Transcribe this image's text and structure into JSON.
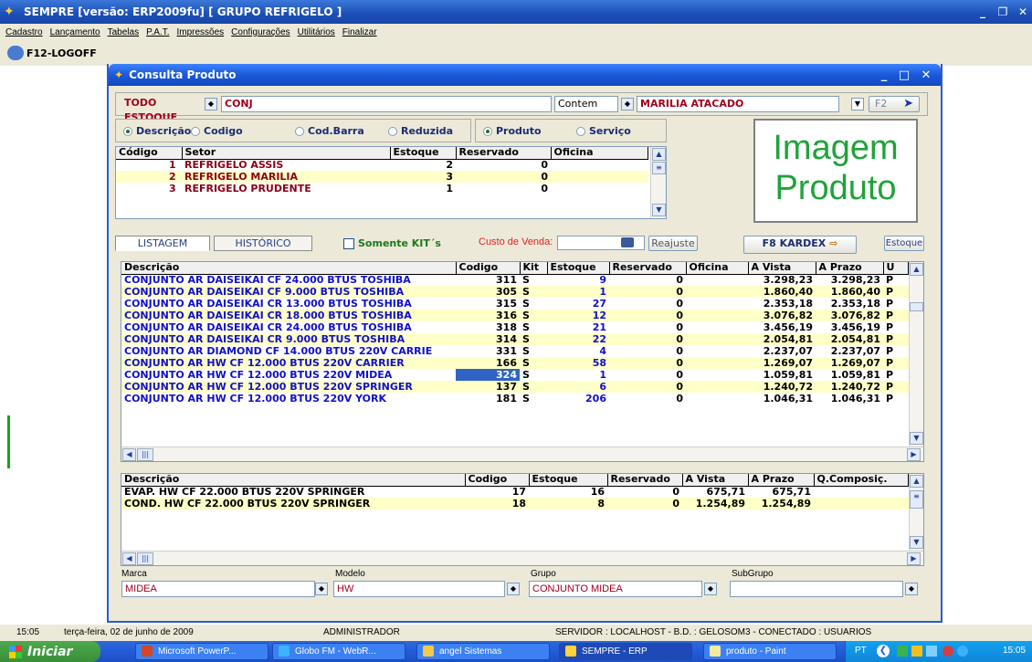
{
  "app": {
    "title": "SEMPRE  [versão: ERP2009fu] [ GRUPO REFRIGELO ]"
  },
  "menu": [
    "Cadastro",
    "Lançamento",
    "Tabelas",
    "P.A.T.",
    "Impressões",
    "Configurações",
    "Utilitários",
    "Finalizar"
  ],
  "toolbar": {
    "logoff_label": "F12-LOGOFF"
  },
  "window": {
    "title": "Consulta Produto"
  },
  "filter": {
    "estoque": "TODO ESTOQUE",
    "search_value": "CONJ",
    "match_mode": "Contem",
    "store": "MARILIA ATACADO",
    "f2_label": "F2"
  },
  "search_by": {
    "options": [
      "Descrição",
      "Codigo",
      "Cod.Barra",
      "Reduzida"
    ],
    "selected": "Descrição"
  },
  "product_type": {
    "options": [
      "Produto",
      "Serviço"
    ],
    "selected": "Produto"
  },
  "image_placeholder": {
    "line1": "Imagem",
    "line2": "Produto"
  },
  "stock_grid": {
    "columns": [
      "Código",
      "Setor",
      "Estoque",
      "Reservado",
      "Oficina"
    ],
    "rows": [
      {
        "codigo": "1",
        "setor": "REFRIGELO ASSIS",
        "estoque": "2",
        "reservado": "0",
        "oficina": ""
      },
      {
        "codigo": "2",
        "setor": "REFRIGELO MARILIA",
        "estoque": "3",
        "reservado": "0",
        "oficina": ""
      },
      {
        "codigo": "3",
        "setor": "REFRIGELO PRUDENTE",
        "estoque": "1",
        "reservado": "0",
        "oficina": ""
      }
    ]
  },
  "tabs": {
    "listagem": "LISTAGEM",
    "historico": "HISTÓRICO"
  },
  "kits_only_label": "Somente KIT´s",
  "custo_venda_label": "Custo de Venda:",
  "reajuste_label": "Reajuste",
  "kardex_label": "F8 KARDEX",
  "estoque_button_label": "Estoque",
  "product_grid": {
    "columns": [
      "Descrição",
      "Codigo",
      "Kit",
      "Estoque",
      "Reservado",
      "Oficina",
      "A Vista",
      "A Prazo",
      "U"
    ],
    "rows": [
      {
        "descricao": "CONJUNTO AR DAISEIKAI CF 24.000 BTUS TOSHIBA",
        "codigo": "311",
        "kit": "S",
        "estoque": "9",
        "reservado": "0",
        "oficina": "",
        "avista": "3.298,23",
        "aprazo": "3.298,23",
        "u": "P"
      },
      {
        "descricao": "CONJUNTO AR DAISEIKAI CF 9.000 BTUS TOSHIBA",
        "codigo": "305",
        "kit": "S",
        "estoque": "1",
        "reservado": "0",
        "oficina": "",
        "avista": "1.860,40",
        "aprazo": "1.860,40",
        "u": "P"
      },
      {
        "descricao": "CONJUNTO AR DAISEIKAI CR 13.000 BTUS TOSHIBA",
        "codigo": "315",
        "kit": "S",
        "estoque": "27",
        "reservado": "0",
        "oficina": "",
        "avista": "2.353,18",
        "aprazo": "2.353,18",
        "u": "P"
      },
      {
        "descricao": "CONJUNTO AR DAISEIKAI CR 18.000 BTUS TOSHIBA",
        "codigo": "316",
        "kit": "S",
        "estoque": "12",
        "reservado": "0",
        "oficina": "",
        "avista": "3.076,82",
        "aprazo": "3.076,82",
        "u": "P"
      },
      {
        "descricao": "CONJUNTO AR DAISEIKAI CR 24.000 BTUS TOSHIBA",
        "codigo": "318",
        "kit": "S",
        "estoque": "21",
        "reservado": "0",
        "oficina": "",
        "avista": "3.456,19",
        "aprazo": "3.456,19",
        "u": "P"
      },
      {
        "descricao": "CONJUNTO AR DAISEIKAI CR 9.000 BTUS TOSHIBA",
        "codigo": "314",
        "kit": "S",
        "estoque": "22",
        "reservado": "0",
        "oficina": "",
        "avista": "2.054,81",
        "aprazo": "2.054,81",
        "u": "P"
      },
      {
        "descricao": "CONJUNTO AR DIAMOND CF 14.000 BTUS 220V CARRIE",
        "codigo": "331",
        "kit": "S",
        "estoque": "4",
        "reservado": "0",
        "oficina": "",
        "avista": "2.237,07",
        "aprazo": "2.237,07",
        "u": "P"
      },
      {
        "descricao": "CONJUNTO AR HW CF 12.000 BTUS 220V CARRIER",
        "codigo": "166",
        "kit": "S",
        "estoque": "58",
        "reservado": "0",
        "oficina": "",
        "avista": "1.269,07",
        "aprazo": "1.269,07",
        "u": "P"
      },
      {
        "descricao": "CONJUNTO AR HW CF 12.000 BTUS 220V MIDEA",
        "codigo": "324",
        "kit": "S",
        "estoque": "1",
        "reservado": "0",
        "oficina": "",
        "avista": "1.059,81",
        "aprazo": "1.059,81",
        "u": "P"
      },
      {
        "descricao": "CONJUNTO AR HW CF 12.000 BTUS 220V SPRINGER",
        "codigo": "137",
        "kit": "S",
        "estoque": "6",
        "reservado": "0",
        "oficina": "",
        "avista": "1.240,72",
        "aprazo": "1.240,72",
        "u": "P"
      },
      {
        "descricao": "CONJUNTO AR HW CF 12.000 BTUS 220V YORK",
        "codigo": "181",
        "kit": "S",
        "estoque": "206",
        "reservado": "0",
        "oficina": "",
        "avista": "1.046,31",
        "aprazo": "1.046,31",
        "u": "P"
      }
    ]
  },
  "composition_grid": {
    "columns": [
      "Descrição",
      "Codigo",
      "Estoque",
      "Reservado",
      "A Vista",
      "A Prazo",
      "Q.Composiç."
    ],
    "rows": [
      {
        "descricao": "EVAP. HW CF 22.000 BTUS 220V SPRINGER",
        "codigo": "17",
        "estoque": "16",
        "reservado": "0",
        "avista": "675,71",
        "aprazo": "675,71",
        "q": ""
      },
      {
        "descricao": "COND. HW CF 22.000 BTUS 220V SPRINGER",
        "codigo": "18",
        "estoque": "8",
        "reservado": "0",
        "avista": "1.254,89",
        "aprazo": "1.254,89",
        "q": ""
      }
    ]
  },
  "bottom_filters": {
    "marca_label": "Marca",
    "marca": "MIDEA",
    "modelo_label": "Modelo",
    "modelo": "HW",
    "grupo_label": "Grupo",
    "grupo": "CONJUNTO MIDEA",
    "subgrupo_label": "SubGrupo",
    "subgrupo": ""
  },
  "status": {
    "time": "15:05",
    "date": "terça-feira, 02 de junho de 2009",
    "user": "ADMINISTRADOR",
    "server": "SERVIDOR : LOCALHOST - B.D. : GELOSOM3 - CONECTADO : USUARIOS"
  },
  "taskbar": {
    "start": "Iniciar",
    "tasks": [
      "Microsoft PowerP...",
      "Globo FM - WebR...",
      "angel Sistemas",
      "SEMPRE - ERP",
      "produto - Paint"
    ],
    "lang": "PT",
    "clock": "15:05"
  },
  "colors": {
    "title_blue": "#1b59d8",
    "row_yellow": "#ffffc8",
    "text_blue": "#1010c8",
    "label_red": "#a0001e",
    "image_text_green": "#1fa33a"
  }
}
